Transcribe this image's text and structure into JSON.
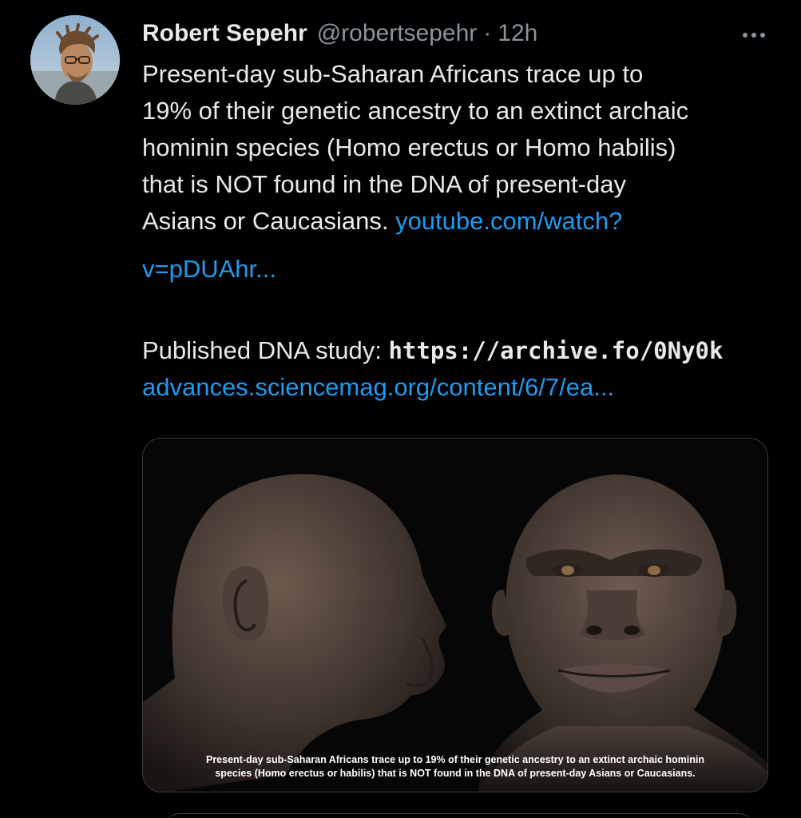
{
  "tweet": {
    "author": {
      "display_name": "Robert Sepehr",
      "handle": "@robertsepehr",
      "separator": "·",
      "time": "12h"
    },
    "more_icon": "more-horizontal-icon",
    "body_lines": [
      "Present-day sub-Saharan Africans trace up to",
      "19% of their genetic ancestry to an extinct archaic",
      "hominin species (Homo erectus or Homo habilis)",
      "that is NOT found in the DNA of present-day"
    ],
    "body_last_line_text": "Asians or Caucasians.",
    "youtube_link_part1": "youtube.com/watch?",
    "youtube_link_part2": "v=pDUAhr...",
    "study_label": "Published DNA study:",
    "archive_link": "https://archive.fo/0Ny0k",
    "sciencemag_link": "advances.sciencemag.org/content/6/7/ea...",
    "media": {
      "caption_line1": "Present-day sub-Saharan Africans trace up to 19% of their genetic ancestry to an extinct archaic hominin",
      "caption_line2": "species (Homo erectus or habilis) that is NOT found in the DNA of present-day Asians or Caucasians."
    },
    "colors": {
      "background": "#000000",
      "text": "#e7e9ea",
      "secondary": "#8b949b",
      "link": "#1d9bf0"
    }
  }
}
